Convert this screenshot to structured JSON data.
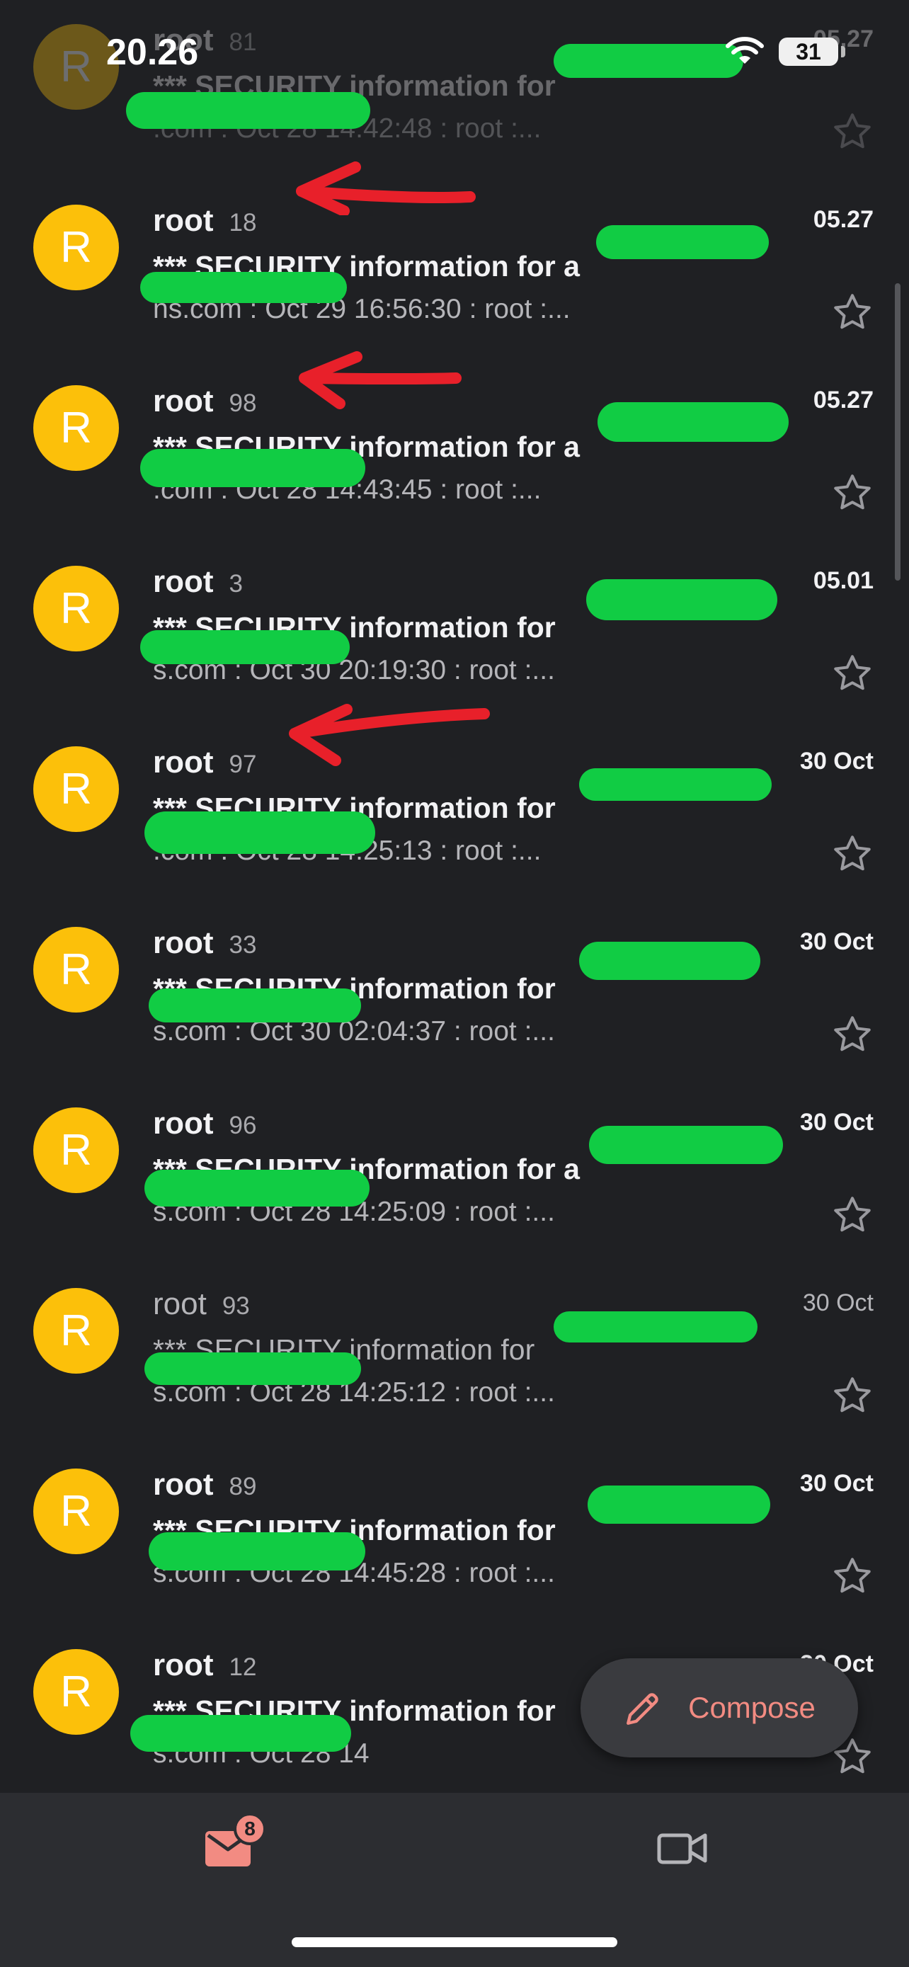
{
  "status_bar": {
    "time": "20.26",
    "battery": "31"
  },
  "messages": [
    {
      "sender": "root",
      "count": "81",
      "date": "05.27",
      "subject": "*** SECURITY information for",
      "snippet": ".com : Oct 28 14:42:48 : root :...",
      "starred": false
    },
    {
      "sender": "root",
      "count": "18",
      "date": "05.27",
      "subject": "*** SECURITY information for a",
      "snippet": "ns.com : Oct 29 16:56:30 : root :...",
      "starred": false
    },
    {
      "sender": "root",
      "count": "98",
      "date": "05.27",
      "subject": "*** SECURITY information for a",
      "snippet": ".com : Oct 28 14:43:45 : root :...",
      "starred": false
    },
    {
      "sender": "root",
      "count": "3",
      "date": "05.01",
      "subject": "*** SECURITY information for",
      "snippet": "s.com : Oct 30 20:19:30 : root :...",
      "starred": false
    },
    {
      "sender": "root",
      "count": "97",
      "date": "30 Oct",
      "subject": "*** SECURITY information for",
      "snippet": ".com : Oct 28 14:25:13 : root :...",
      "starred": false
    },
    {
      "sender": "root",
      "count": "33",
      "date": "30 Oct",
      "subject": "*** SECURITY information for",
      "snippet": "s.com : Oct 30 02:04:37 : root :...",
      "starred": false
    },
    {
      "sender": "root",
      "count": "96",
      "date": "30 Oct",
      "subject": "*** SECURITY information for a",
      "snippet": "s.com : Oct 28 14:25:09 : root :...",
      "starred": false
    },
    {
      "sender": "root",
      "count": "93",
      "date": "30 Oct",
      "subject": "*** SECURITY information for",
      "snippet": "s.com : Oct 28 14:25:12 : root :...",
      "starred": false
    },
    {
      "sender": "root",
      "count": "89",
      "date": "30 Oct",
      "subject": "*** SECURITY information for",
      "snippet": "s.com : Oct 28 14:45:28 : root :...",
      "starred": false
    },
    {
      "sender": "root",
      "count": "12",
      "date": "30 Oct",
      "subject": "*** SECURITY information for",
      "snippet": "s.com : Oct 28 14",
      "starred": false
    }
  ],
  "avatar_letter": "R",
  "compose": {
    "label": "Compose"
  },
  "bottom_nav": {
    "mail_badge": "8"
  },
  "colors": {
    "background": "#1f2023",
    "avatar": "#fcc00a",
    "accent": "#f28b82",
    "redaction": "#11cc44",
    "annotation_arrow": "#e8202a"
  },
  "icons": [
    "wifi-icon",
    "star-icon",
    "pencil-icon",
    "mail-icon",
    "video-icon"
  ]
}
